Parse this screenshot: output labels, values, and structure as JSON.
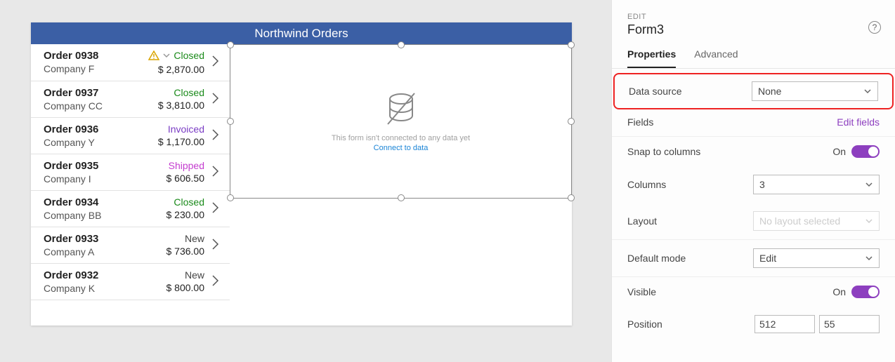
{
  "app": {
    "title": "Northwind Orders"
  },
  "orders": [
    {
      "id": "Order 0938",
      "company": "Company F",
      "status": "Closed",
      "statusClass": "closed",
      "amount": "$ 2,870.00",
      "warn": true
    },
    {
      "id": "Order 0937",
      "company": "Company CC",
      "status": "Closed",
      "statusClass": "closed",
      "amount": "$ 3,810.00",
      "warn": false
    },
    {
      "id": "Order 0936",
      "company": "Company Y",
      "status": "Invoiced",
      "statusClass": "invoiced",
      "amount": "$ 1,170.00",
      "warn": false
    },
    {
      "id": "Order 0935",
      "company": "Company I",
      "status": "Shipped",
      "statusClass": "shipped",
      "amount": "$ 606.50",
      "warn": false
    },
    {
      "id": "Order 0934",
      "company": "Company BB",
      "status": "Closed",
      "statusClass": "closed",
      "amount": "$ 230.00",
      "warn": false
    },
    {
      "id": "Order 0933",
      "company": "Company A",
      "status": "New",
      "statusClass": "new-s",
      "amount": "$ 736.00",
      "warn": false
    },
    {
      "id": "Order 0932",
      "company": "Company K",
      "status": "New",
      "statusClass": "new-s",
      "amount": "$ 800.00",
      "warn": false
    }
  ],
  "emptyForm": {
    "message": "This form isn't connected to any data yet",
    "link": "Connect to data"
  },
  "panel": {
    "editLabel": "EDIT",
    "name": "Form3",
    "tabs": {
      "properties": "Properties",
      "advanced": "Advanced"
    },
    "dataSourceLabel": "Data source",
    "dataSourceValue": "None",
    "fieldsLabel": "Fields",
    "editFields": "Edit fields",
    "snapLabel": "Snap to columns",
    "onText": "On",
    "columnsLabel": "Columns",
    "columnsValue": "3",
    "layoutLabel": "Layout",
    "layoutValue": "No layout selected",
    "defaultModeLabel": "Default mode",
    "defaultModeValue": "Edit",
    "visibleLabel": "Visible",
    "positionLabel": "Position",
    "posX": "512",
    "posY": "55"
  }
}
